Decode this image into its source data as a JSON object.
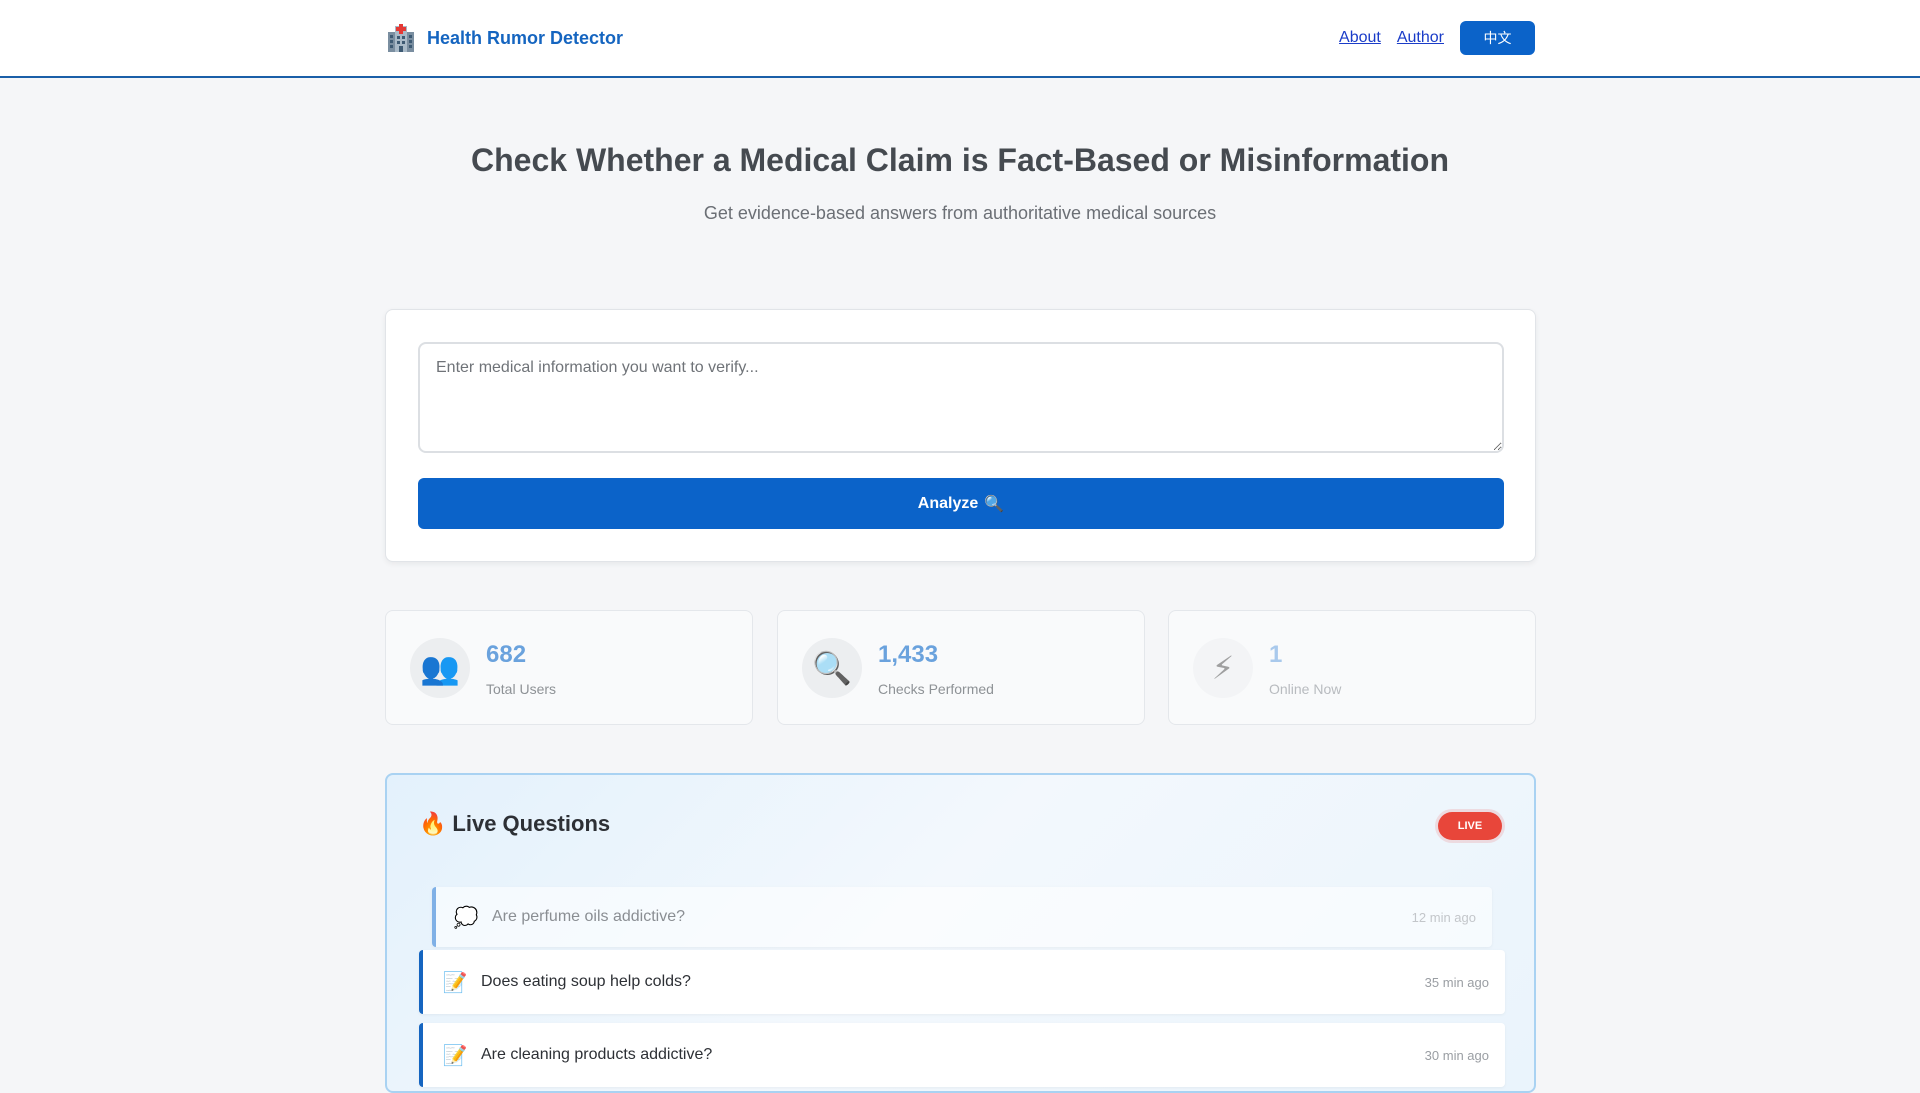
{
  "header": {
    "brand_title": "Health Rumor Detector",
    "nav_about": "About",
    "nav_author": "Author",
    "lang_toggle": "中文"
  },
  "hero": {
    "title": "Check Whether a Medical Claim is Fact-Based or Misinformation",
    "subtitle": "Get evidence-based answers from authoritative medical sources"
  },
  "check_form": {
    "placeholder": "Enter medical information you want to verify...",
    "value": "",
    "analyze_label": "Analyze",
    "analyze_icon": "🔍"
  },
  "stats": [
    {
      "icon": "👥",
      "value": "682",
      "label": "Total Users"
    },
    {
      "icon": "🔍",
      "value": "1,433",
      "label": "Checks Performed"
    },
    {
      "icon": "⚡",
      "value": "1",
      "label": "Online Now"
    }
  ],
  "live": {
    "title_icon": "🔥",
    "title": "Live Questions",
    "badge": "LIVE",
    "questions": [
      {
        "icon": "💭",
        "text": "Are perfume oils addictive?",
        "time": "12 min ago"
      },
      {
        "icon": "📝",
        "text": "Does eating soup help colds?",
        "time": "35 min ago"
      },
      {
        "icon": "📝",
        "text": "Are cleaning products addictive?",
        "time": "30 min ago"
      }
    ]
  },
  "colors": {
    "brand_blue": "#1565c0",
    "primary_button": "#0b63c9",
    "live_badge": "#e8463a"
  }
}
